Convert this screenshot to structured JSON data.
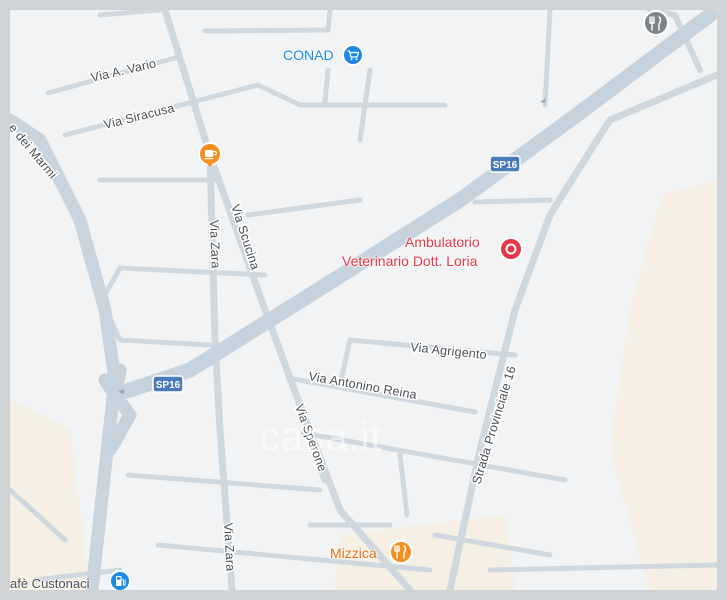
{
  "map": {
    "colors": {
      "background": "#f2f3f4",
      "road": "#cfd8df",
      "road_major": "#c6d2dc",
      "land_beige": "#f6efe3",
      "frame": "#cfd3d6",
      "shield": "#4a7ab8",
      "vet_marker": "#e5394a",
      "shop_marker": "#1e88e5",
      "food_marker": "#f29020",
      "fuel_marker": "#1e88e5"
    },
    "streets": {
      "via_vario": "Via A. Vario",
      "via_siracusa": "Via Siracusa",
      "dei_marmi": "e dei Marmi",
      "via_scucina": "Via Scucina",
      "via_zara_upper": "Via Zara",
      "via_zara_lower": "Via Zara",
      "via_agrigento": "Via Agrigento",
      "via_reina": "Via Antonino Reina",
      "via_sperone": "Via Sperone",
      "strada_provinciale": "Strada Provinciale 16"
    },
    "shields": {
      "sp16_upper": "SP16",
      "sp16_lower": "SP16"
    },
    "pois": {
      "conad": {
        "name": "CONAD",
        "icon": "shopping-cart-icon"
      },
      "vet_line1": "Ambulatorio",
      "vet_line2": "Veterinario Dott. Loria",
      "vet_icon": "location-pin-icon",
      "mizzica": {
        "name": "Mizzica",
        "icon": "restaurant-icon"
      },
      "cafe": {
        "name": "afè Custonaci",
        "icon": "gas-station-icon"
      },
      "coffee_icon": "coffee-cup-icon",
      "top_restaurant_icon": "restaurant-icon"
    },
    "watermark": "casa.it"
  }
}
